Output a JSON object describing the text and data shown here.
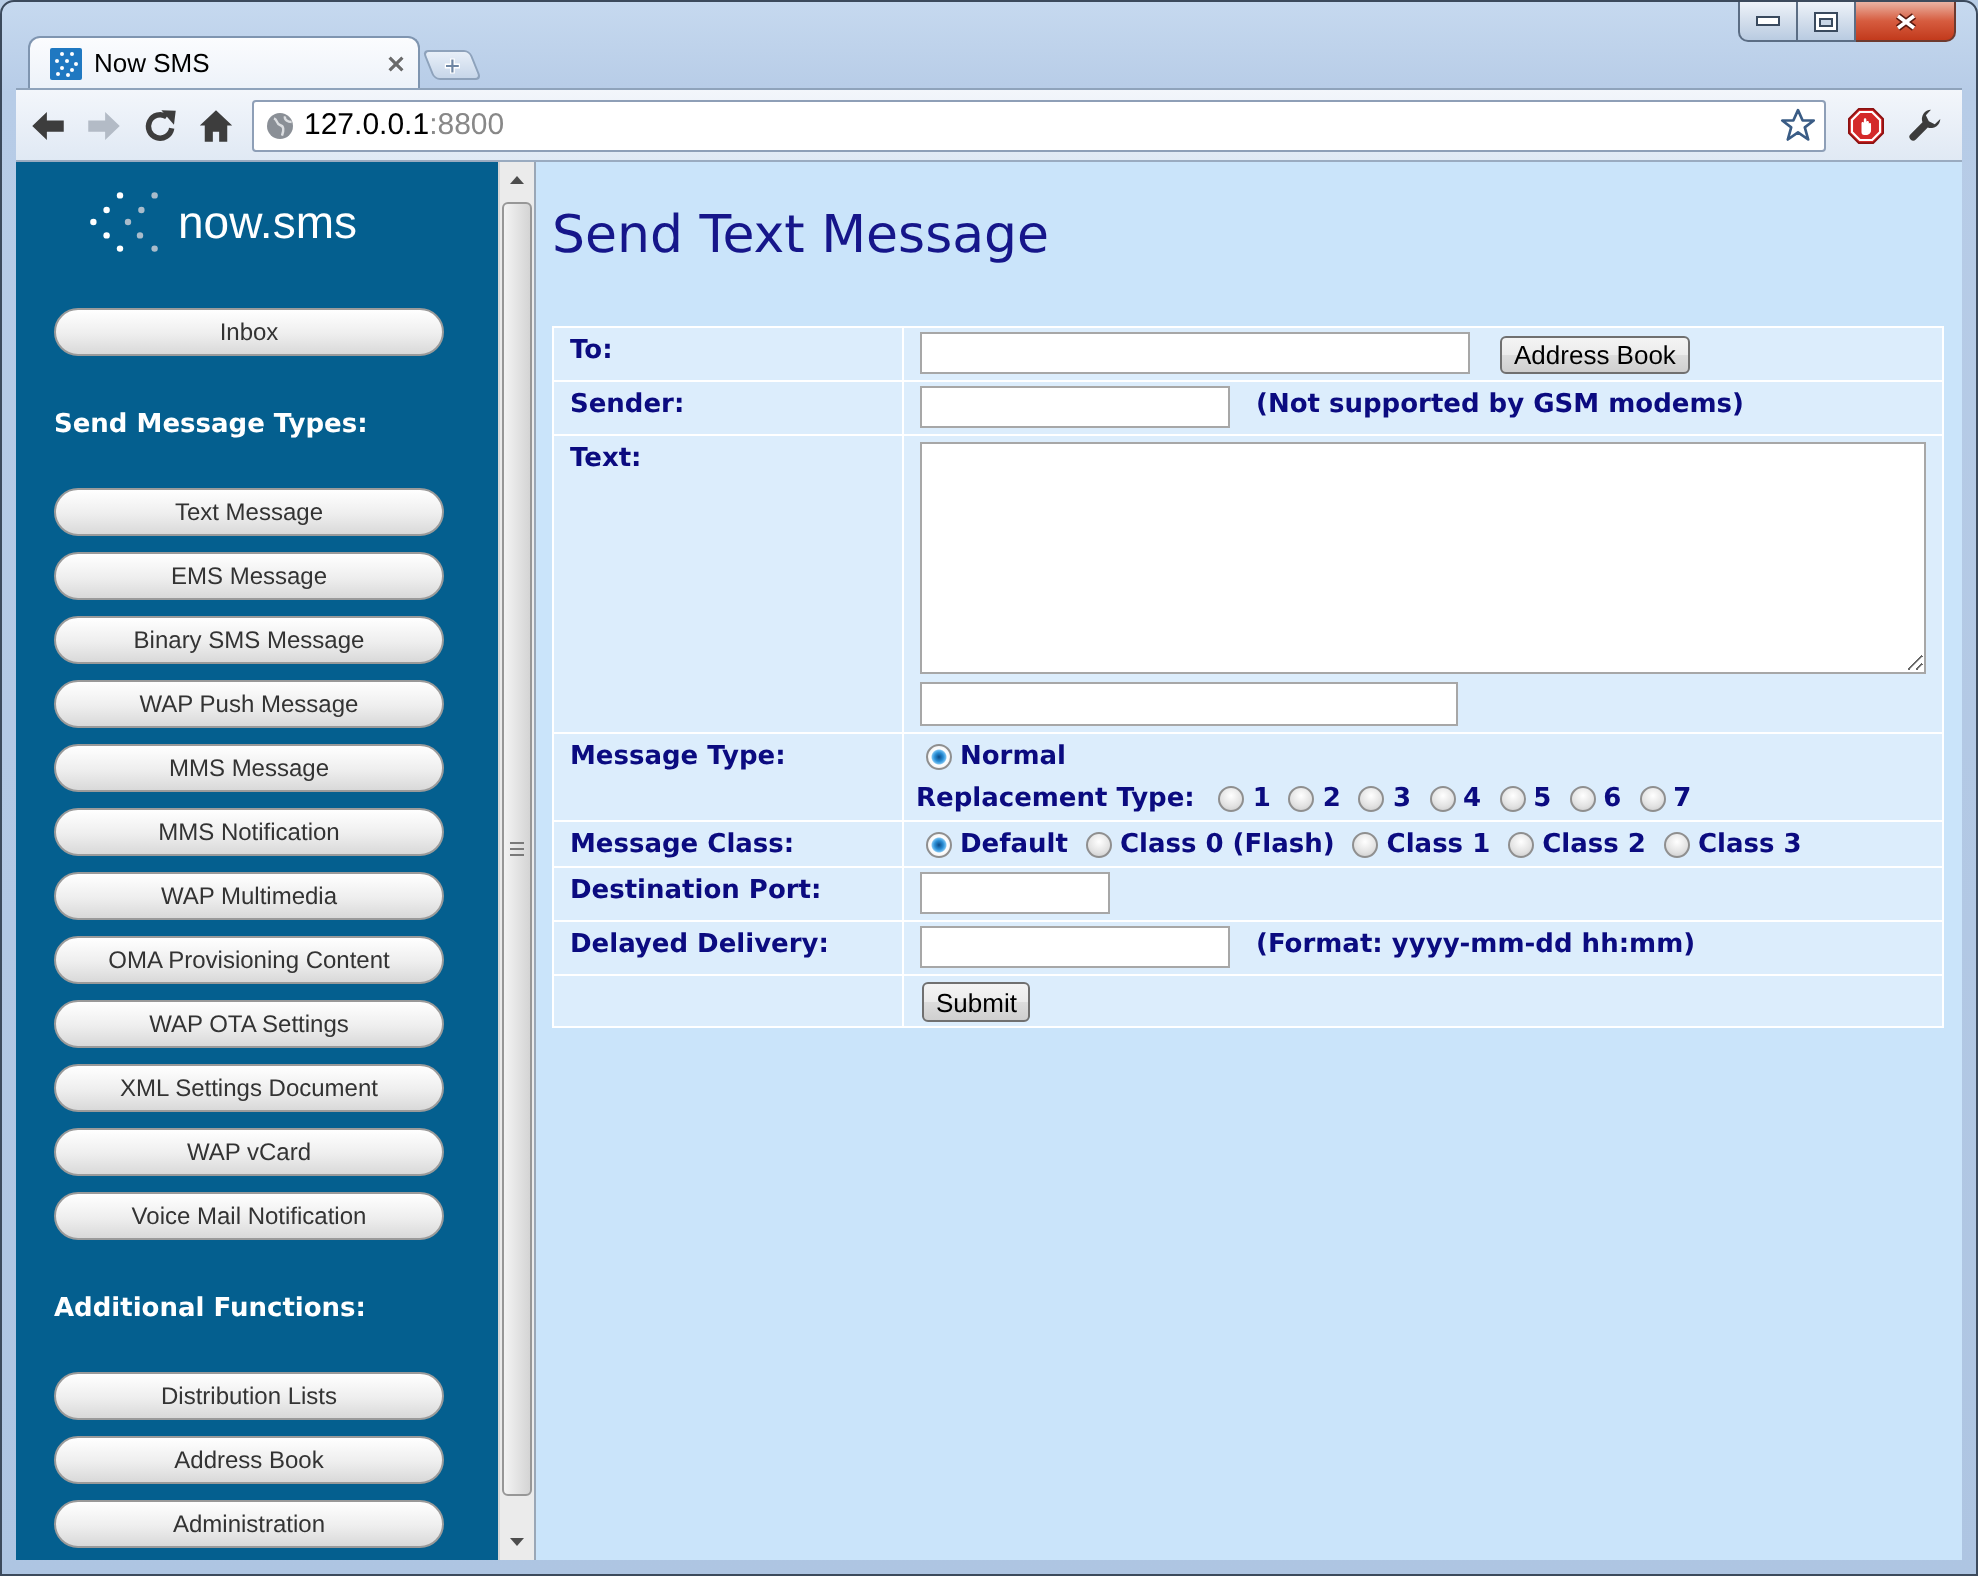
{
  "browser": {
    "tabs": [
      {
        "title": "Now SMS",
        "selected": true
      }
    ],
    "nav_buttons": [
      {
        "kind": "back",
        "disabled": false
      },
      {
        "kind": "forward",
        "disabled": true
      },
      {
        "kind": "reload",
        "disabled": false
      },
      {
        "kind": "home",
        "disabled": false
      }
    ],
    "address_bar": {
      "host": "127.0.0.1",
      "port": ":8800"
    }
  },
  "sidebar": {
    "logo": "now.sms",
    "items": [
      {
        "kind": "button",
        "label": "Inbox"
      },
      {
        "kind": "heading",
        "label": "Send Message Types:"
      },
      {
        "kind": "button",
        "label": "Text Message"
      },
      {
        "kind": "button",
        "label": "EMS Message"
      },
      {
        "kind": "button",
        "label": "Binary SMS Message"
      },
      {
        "kind": "button",
        "label": "WAP Push Message"
      },
      {
        "kind": "button",
        "label": "MMS Message"
      },
      {
        "kind": "button",
        "label": "MMS Notification"
      },
      {
        "kind": "button",
        "label": "WAP Multimedia"
      },
      {
        "kind": "button",
        "label": "OMA Provisioning Content"
      },
      {
        "kind": "button",
        "label": "WAP OTA Settings"
      },
      {
        "kind": "button",
        "label": "XML Settings Document"
      },
      {
        "kind": "button",
        "label": "WAP vCard"
      },
      {
        "kind": "button",
        "label": "Voice Mail Notification"
      },
      {
        "kind": "heading",
        "label": "Additional Functions:"
      },
      {
        "kind": "button",
        "label": "Distribution Lists"
      },
      {
        "kind": "button",
        "label": "Address Book"
      },
      {
        "kind": "button",
        "label": "Administration"
      }
    ]
  },
  "page": {
    "title": "Send Text Message",
    "form": {
      "rows": [
        {
          "kind": "to",
          "label": "To:",
          "button": "Address Book"
        },
        {
          "kind": "sender",
          "label": "Sender:",
          "note": "(Not supported by GSM modems)"
        },
        {
          "kind": "text",
          "label": "Text:"
        },
        {
          "kind": "message_type",
          "label": "Message Type:",
          "options": [
            {
              "label": "Normal",
              "selected": true
            }
          ],
          "replacement_label": "Replacement Type:",
          "replacement_options": [
            {
              "label": "1",
              "selected": false
            },
            {
              "label": "2",
              "selected": false
            },
            {
              "label": "3",
              "selected": false
            },
            {
              "label": "4",
              "selected": false
            },
            {
              "label": "5",
              "selected": false
            },
            {
              "label": "6",
              "selected": false
            },
            {
              "label": "7",
              "selected": false
            }
          ]
        },
        {
          "kind": "message_class",
          "label": "Message Class:",
          "options": [
            {
              "label": "Default",
              "selected": true
            },
            {
              "label": "Class 0 (Flash)",
              "selected": false
            },
            {
              "label": "Class 1",
              "selected": false
            },
            {
              "label": "Class 2",
              "selected": false
            },
            {
              "label": "Class 3",
              "selected": false
            }
          ]
        },
        {
          "kind": "port",
          "label": "Destination Port:"
        },
        {
          "kind": "delayed",
          "label": "Delayed Delivery:",
          "note": "(Format: yyyy-mm-dd hh:mm)"
        },
        {
          "kind": "submit",
          "button": "Submit"
        }
      ]
    }
  }
}
